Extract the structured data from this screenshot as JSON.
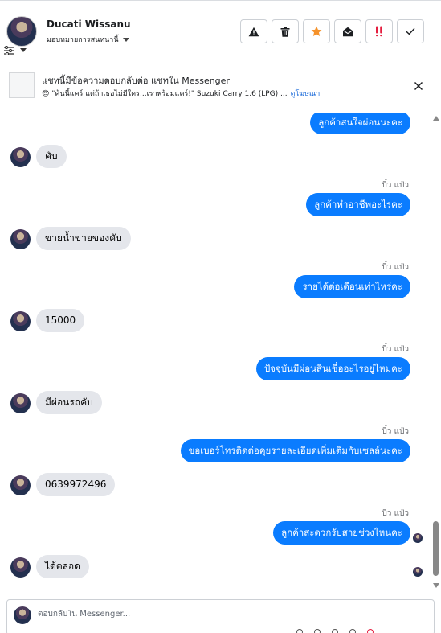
{
  "header": {
    "contact_name": "Ducati Wissanu",
    "assign_label": "มอบหมายการสนทนานี้",
    "actions": [
      {
        "name": "spam-button",
        "icon": "warning-icon"
      },
      {
        "name": "delete-button",
        "icon": "trash-icon"
      },
      {
        "name": "star-button",
        "icon": "star-icon"
      },
      {
        "name": "mark-unread-button",
        "icon": "envelope-open-icon"
      },
      {
        "name": "follow-up-button",
        "icon": "exclamation-icon"
      },
      {
        "name": "done-button",
        "icon": "check-icon"
      }
    ]
  },
  "banner": {
    "title": "แชทนี้มีข้อความตอบกลับต่อ แชทใน Messenger",
    "subtitle": "😎 \"ค้นนี้แคร์ แต่ถ้าเธอไม่มีใคร...เราพร้อมแคร์!\" Suzuki Carry 1.6 (LPG) ...",
    "link": "ดูโฆษณา"
  },
  "chat": {
    "messages": [
      {
        "dir": "out",
        "text": "ลูกค้าสนใจผ่อนนะคะ"
      },
      {
        "dir": "in",
        "text": "คับ"
      },
      {
        "dir": "out",
        "sender": "บิ๋ว แป๋ว",
        "text": "ลูกค้าทำอาชีพอะไรคะ"
      },
      {
        "dir": "in",
        "text": "ขายน้ำขายของคับ"
      },
      {
        "dir": "out",
        "sender": "บิ๋ว แป๋ว",
        "text": "รายได้ต่อเดือนเท่าไหร่คะ"
      },
      {
        "dir": "in",
        "text": "15000"
      },
      {
        "dir": "out",
        "sender": "บิ๋ว แป๋ว",
        "text": "ปัจจุบันมีผ่อนสินเชื่ออะไรอยู่ไหมคะ"
      },
      {
        "dir": "in",
        "text": "มีผ่อนรถคับ"
      },
      {
        "dir": "out",
        "sender": "บิ๋ว แป๋ว",
        "text": "ขอเบอร์โทรติดต่อคุยรายละเอียดเพิ่มเติมกับเซลล์นะคะ"
      },
      {
        "dir": "in",
        "text": "0639972496"
      },
      {
        "dir": "out",
        "sender": "บิ๋ว แป๋ว",
        "text": "ลูกค้าสะดวกรับสายช่วงไหนคะ"
      },
      {
        "dir": "in",
        "text": "ได้ตลอด"
      }
    ]
  },
  "composer": {
    "placeholder": "ตอบกลับใน Messenger..."
  },
  "colors": {
    "outgoing_bubble": "#0a7cff",
    "incoming_bubble": "#e4e6eb",
    "link": "#216fdb",
    "star": "#f5922a",
    "alert": "#e41e3f"
  }
}
